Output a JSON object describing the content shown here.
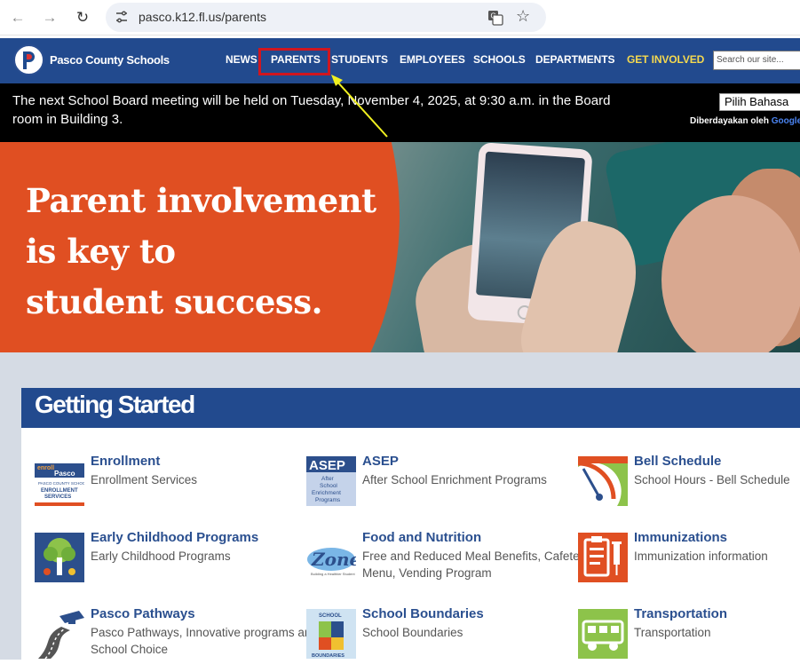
{
  "browser": {
    "url": "pasco.k12.fl.us/parents",
    "back_icon": "arrow-left-icon",
    "forward_icon": "arrow-right-icon",
    "reload_icon": "reload-icon"
  },
  "header": {
    "logo_text": "Pasco County Schools",
    "nav": [
      "NEWS",
      "PARENTS",
      "STUDENTS",
      "EMPLOYEES",
      "SCHOOLS",
      "DEPARTMENTS",
      "GET INVOLVED"
    ],
    "search_placeholder": "Search our site..."
  },
  "notice": {
    "text": "The next School Board meeting will be held on Tuesday, November 4, 2025, at 9:30 a.m. in the Board room in Building 3.",
    "language_select": "Pilih Bahasa",
    "powered_by": "Diberdayakan oleh",
    "google": "Google"
  },
  "hero": {
    "line1": "Parent involvement",
    "line2": "is key to",
    "line3": "student success."
  },
  "getting_started": {
    "title": "Getting Started",
    "items": [
      {
        "title": "Enrollment",
        "desc": "Enrollment Services",
        "icon": "enroll-pasco-icon",
        "icon_text": "enroll Pasco"
      },
      {
        "title": "ASEP",
        "desc": "After School Enrichment Programs",
        "icon": "asep-icon",
        "icon_text": "ASEP"
      },
      {
        "title": "Bell Schedule",
        "desc": "School Hours - Bell Schedule",
        "icon": "bell-schedule-gauge-icon"
      },
      {
        "title": "Early Childhood Programs",
        "desc": "Early Childhood Programs",
        "icon": "tree-icon"
      },
      {
        "title": "Food and Nutrition",
        "desc": "Free and Reduced Meal Benefits, Cafeteria Menu, Vending Program",
        "icon": "zone-icon",
        "icon_text": "Zone"
      },
      {
        "title": "Immunizations",
        "desc": "Immunization information",
        "icon": "clipboard-syringe-icon"
      },
      {
        "title": "Pasco Pathways",
        "desc": "Pasco Pathways, Innovative programs and School Choice",
        "icon": "graduation-road-icon"
      },
      {
        "title": "School Boundaries",
        "desc": "School Boundaries",
        "icon": "school-boundaries-map-icon",
        "icon_text": "SCHOOL BOUNDARIES"
      },
      {
        "title": "Transportation",
        "desc": "Transportation",
        "icon": "bus-icon"
      }
    ]
  }
}
